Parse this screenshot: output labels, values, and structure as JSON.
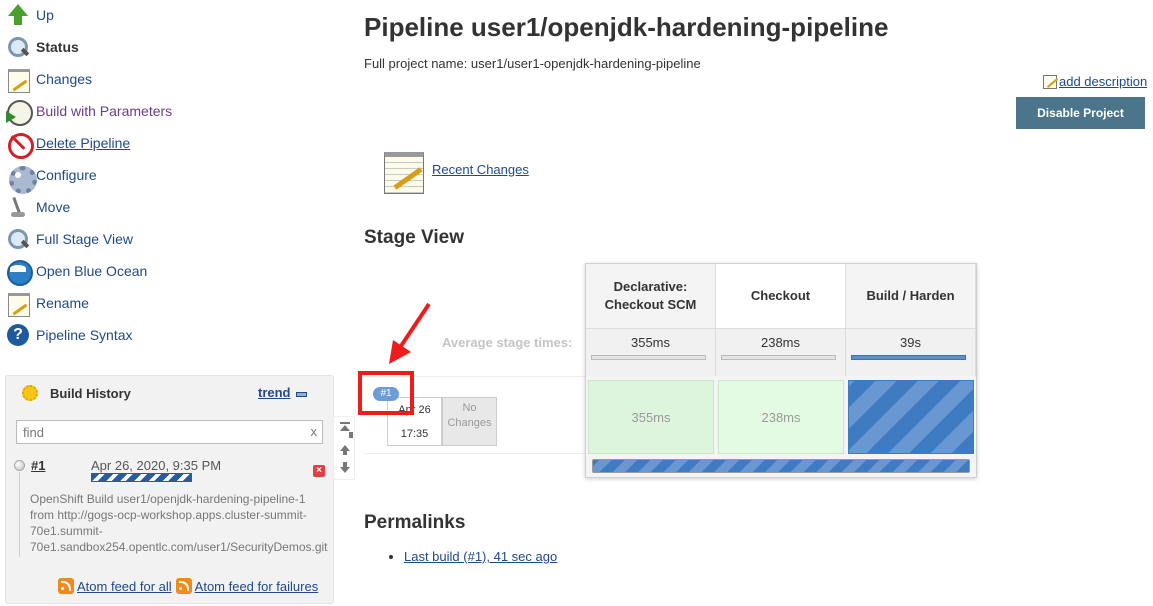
{
  "sidebar": {
    "items": [
      {
        "label": "Up",
        "icon": "up-arrow-icon"
      },
      {
        "label": "Status",
        "icon": "magnifier-icon"
      },
      {
        "label": "Changes",
        "icon": "notepad-icon"
      },
      {
        "label": "Build with Parameters",
        "icon": "clock-play-icon"
      },
      {
        "label": "Delete Pipeline",
        "icon": "no-entry-icon"
      },
      {
        "label": "Configure",
        "icon": "gear-icon"
      },
      {
        "label": "Move",
        "icon": "move-icon"
      },
      {
        "label": "Full Stage View",
        "icon": "magnifier-icon"
      },
      {
        "label": "Open Blue Ocean",
        "icon": "blue-ocean-icon"
      },
      {
        "label": "Rename",
        "icon": "notepad-icon"
      },
      {
        "label": "Pipeline Syntax",
        "icon": "help-icon"
      }
    ]
  },
  "build_history": {
    "title": "Build History",
    "trend_label": "trend",
    "search_placeholder": "find",
    "clear_glyph": "x",
    "builds": [
      {
        "number": "#1",
        "date": "Apr 26, 2020, 9:35 PM",
        "description": "OpenShift Build user1/openjdk-hardening-pipeline-1 from http://gogs-ocp-workshop.apps.cluster-summit-70e1.summit-70e1.sandbox254.opentlc.com/user1/SecurityDemos.git"
      }
    ],
    "feed_all": "Atom feed for all",
    "feed_failures": "Atom feed for failures"
  },
  "main": {
    "title": "Pipeline user1/openjdk-hardening-pipeline",
    "full_project_name": "Full project name: user1/user1-openjdk-hardening-pipeline",
    "add_description": "add description",
    "disable_button": "Disable Project",
    "recent_changes": "Recent Changes",
    "stage_view_title": "Stage View",
    "permalinks_title": "Permalinks",
    "permalinks": [
      "Last build (#1), 41 sec ago"
    ]
  },
  "stage_view": {
    "avg_label": "Average stage times:",
    "stages": [
      {
        "name": "Declarative: Checkout SCM",
        "avg": "355ms",
        "avg_progress": 0,
        "run_time": "355ms",
        "status": "success"
      },
      {
        "name": "Checkout",
        "avg": "238ms",
        "avg_progress": 0,
        "run_time": "238ms",
        "status": "success"
      },
      {
        "name": "Build / Harden",
        "avg": "39s",
        "avg_progress": 1,
        "run_time": "",
        "status": "running"
      }
    ],
    "run": {
      "badge": "#1",
      "date": "Apr 26",
      "time": "17:35",
      "changes": "No Changes"
    }
  },
  "colors": {
    "link": "#204a87",
    "button": "#4b758b",
    "annotation": "#ee1c1c",
    "running": "#3f7bc0",
    "success_cell": "#ddf5dd"
  }
}
